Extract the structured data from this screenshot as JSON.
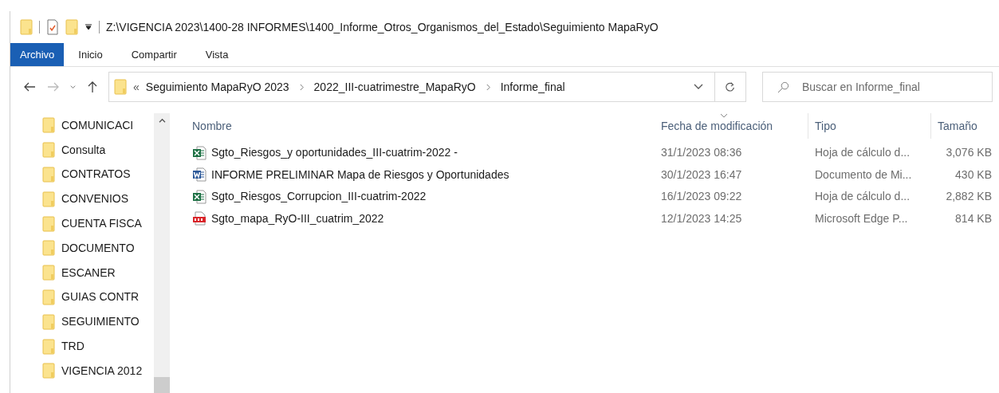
{
  "title_bar": {
    "path": "Z:\\VIGENCIA 2023\\1400-28 INFORMES\\1400_Informe_Otros_Organismos_del_Estado\\Seguimiento MapaRyO"
  },
  "ribbon_tabs": [
    {
      "label": "Archivo",
      "kind": "file_menu"
    },
    {
      "label": "Inicio",
      "kind": "tab"
    },
    {
      "label": "Compartir",
      "kind": "tab"
    },
    {
      "label": "Vista",
      "kind": "tab"
    }
  ],
  "address_bar": {
    "overflow": "«",
    "crumbs": [
      "Seguimiento MapaRyO 2023",
      "2022_III-cuatrimestre_MapaRyO",
      "Informe_final"
    ]
  },
  "search": {
    "placeholder": "Buscar en Informe_final"
  },
  "sidebar": {
    "items": [
      "COMUNICACI",
      "Consulta",
      "CONTRATOS",
      "CONVENIOS",
      "CUENTA FISCA",
      "DOCUMENTO",
      "ESCANER",
      "GUIAS CONTR",
      "SEGUIMIENTO",
      "TRD",
      "VIGENCIA 2012"
    ]
  },
  "table": {
    "columns": [
      {
        "label": "Nombre",
        "sorted": false
      },
      {
        "label": "Fecha de modificación",
        "sorted": true
      },
      {
        "label": "Tipo",
        "sorted": false
      },
      {
        "label": "Tamaño",
        "sorted": false
      }
    ],
    "rows": [
      {
        "kind": "excel",
        "name": "Sgto_Riesgos_y oportunidades_III-cuatrim-2022 -",
        "date": "31/1/2023 08:36",
        "type": "Hoja de cálculo d...",
        "size": "3,076 KB"
      },
      {
        "kind": "word",
        "name": "INFORME PRELIMINAR Mapa de Riesgos y Oportunidades",
        "date": "30/1/2023 16:47",
        "type": "Documento de Mi...",
        "size": "430 KB"
      },
      {
        "kind": "excel",
        "name": "Sgto_Riesgos_Corrupcion_III-cuatrim-2022",
        "date": "16/1/2023 09:22",
        "type": "Hoja de cálculo d...",
        "size": "2,882 KB"
      },
      {
        "kind": "pdf",
        "name": "Sgto_mapa_RyO-III_cuatrim_2022",
        "date": "12/1/2023 14:25",
        "type": "Microsoft Edge P...",
        "size": "814 KB"
      }
    ]
  }
}
